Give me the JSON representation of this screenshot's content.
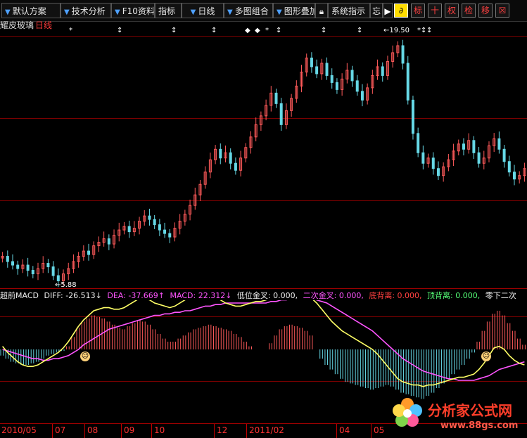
{
  "toolbar": {
    "default_scheme": "默认方案",
    "tech_analysis": "技术分析",
    "f10": "F10资料",
    "indicator": "指标",
    "daily": "日线",
    "multi_chart": "多图组合",
    "overlay": "图形叠加",
    "system_indicator": "系统指示",
    "wisdom": "忘",
    "btn_play": "▶",
    "btn_biao": "标",
    "btn_plus": "十",
    "btn_quan": "权",
    "btn_cha": "检",
    "btn_move": "移",
    "btn_zoom": "☒"
  },
  "stock": {
    "name": "耀皮玻璃",
    "period": "日线"
  },
  "price_chart": {
    "high_label": "19.50",
    "low_label": "5.88",
    "markers": [
      "*",
      "↕",
      "↕",
      "↕",
      "◆",
      "◆",
      "*",
      "↕",
      "↕",
      "↕",
      "↕",
      "↕",
      "*"
    ]
  },
  "macd_header": {
    "name": "超前MACD",
    "diff": "DIFF: -26.513↓",
    "dea": "DEA: -37.669↑",
    "macd": "MACD: 22.312↓",
    "low_gold": "低位金叉: 0.000,",
    "second_gold": "二次金叉: 0.000,",
    "bottom_div": "底背离: 0.000,",
    "top_div": "顶背离: 0.000,",
    "zero_second": "零下二次"
  },
  "x_axis": {
    "labels": [
      "2010/05",
      "07",
      "08",
      "09",
      "10",
      "12",
      "2011/02",
      "04",
      "05"
    ]
  },
  "brand": {
    "title": "分析家公式网",
    "url": "www.88gs.com"
  },
  "colors": {
    "up": "#ff5a5a",
    "down": "#66d8e6",
    "diff": "#ffff66",
    "dea": "#ff55ff",
    "grid": "#7a0000"
  },
  "chart_data": {
    "type": "candlestick",
    "price_range": [
      5.88,
      19.5
    ],
    "closes": [
      7.3,
      7.0,
      6.8,
      6.6,
      6.8,
      6.5,
      6.3,
      6.6,
      6.9,
      6.7,
      6.2,
      5.9,
      6.3,
      6.6,
      7.0,
      7.3,
      7.6,
      7.4,
      7.9,
      8.1,
      8.3,
      8.0,
      8.5,
      8.8,
      9.0,
      8.7,
      8.9,
      9.3,
      9.6,
      9.4,
      9.1,
      8.8,
      8.6,
      8.4,
      8.9,
      9.3,
      9.7,
      10.2,
      10.8,
      11.4,
      12.1,
      12.8,
      13.4,
      12.9,
      13.2,
      12.6,
      12.2,
      12.9,
      13.5,
      14.1,
      14.8,
      15.3,
      15.9,
      16.6,
      16.0,
      14.8,
      15.6,
      16.3,
      17.0,
      17.8,
      18.6,
      18.1,
      17.7,
      18.3,
      17.6,
      17.2,
      16.8,
      17.4,
      17.9,
      17.3,
      16.7,
      16.2,
      16.9,
      17.6,
      18.1,
      17.6,
      18.4,
      18.9,
      19.3,
      18.3,
      16.2,
      14.3,
      13.2,
      12.6,
      12.9,
      12.3,
      11.9,
      12.4,
      12.8,
      13.3,
      13.7,
      13.4,
      13.9,
      13.2,
      12.6,
      12.9,
      13.6,
      14.0,
      13.4,
      12.7,
      12.1,
      11.7,
      11.9,
      12.3
    ],
    "macd_bars": [
      -0.4,
      -0.6,
      -0.8,
      -0.9,
      -1.0,
      -1.0,
      -0.9,
      -0.8,
      -0.6,
      -0.4,
      -0.3,
      -0.2,
      -0.1,
      0.2,
      0.8,
      1.4,
      1.8,
      2.0,
      2.2,
      2.1,
      2.0,
      1.8,
      1.6,
      1.4,
      1.3,
      1.5,
      1.7,
      1.9,
      1.8,
      1.6,
      1.3,
      1.0,
      0.7,
      0.5,
      0.5,
      0.7,
      0.9,
      1.1,
      1.3,
      1.4,
      1.5,
      1.6,
      1.5,
      1.4,
      1.3,
      1.2,
      1.0,
      0.8,
      0.5,
      0.2,
      0.0,
      0.0,
      0.0,
      0.4,
      0.9,
      1.3,
      1.5,
      1.6,
      1.5,
      1.4,
      1.2,
      0.9,
      0.0,
      -0.6,
      -1.0,
      -1.3,
      -1.6,
      -1.9,
      -2.1,
      -2.2,
      -2.3,
      -2.4,
      -2.5,
      -2.6,
      -2.5,
      -2.4,
      -2.3,
      -2.4,
      -2.6,
      -2.8,
      -2.9,
      -3.0,
      -3.1,
      -3.2,
      -3.0,
      -2.8,
      -2.5,
      -2.2,
      -1.9,
      -1.6,
      -1.3,
      -1.0,
      -0.6,
      -0.2,
      0.5,
      1.2,
      1.8,
      2.3,
      2.5,
      2.2,
      1.7,
      1.2,
      0.7,
      0.3
    ],
    "diff": [
      0.2,
      -0.2,
      -0.5,
      -0.8,
      -1.0,
      -1.1,
      -1.1,
      -1.0,
      -0.8,
      -0.6,
      -0.4,
      -0.2,
      0.1,
      0.5,
      1.0,
      1.5,
      1.9,
      2.2,
      2.5,
      2.6,
      2.7,
      2.7,
      2.6,
      2.6,
      2.7,
      2.9,
      3.1,
      3.3,
      3.3,
      3.2,
      3.0,
      2.9,
      2.8,
      2.7,
      2.8,
      3.0,
      3.2,
      3.4,
      3.5,
      3.6,
      3.7,
      3.6,
      3.4,
      3.2,
      3.0,
      2.9,
      2.8,
      2.8,
      2.9,
      3.0,
      3.1,
      3.1,
      3.2,
      3.3,
      3.4,
      3.5,
      3.6,
      3.7,
      3.7,
      3.6,
      3.5,
      3.3,
      3.0,
      2.6,
      2.2,
      1.8,
      1.5,
      1.2,
      1.0,
      0.8,
      0.6,
      0.4,
      0.2,
      0.0,
      -0.3,
      -0.7,
      -1.1,
      -1.5,
      -1.9,
      -2.1,
      -2.2,
      -2.3,
      -2.3,
      -2.4,
      -2.3,
      -2.3,
      -2.2,
      -2.1,
      -2.0,
      -1.9,
      -1.8,
      -1.8,
      -1.7,
      -1.6,
      -1.3,
      -0.9,
      -0.4,
      0.1,
      0.2,
      0.0,
      -0.4,
      -0.7,
      -0.9,
      -1.0
    ],
    "dea": [
      0.0,
      -0.1,
      -0.2,
      -0.3,
      -0.4,
      -0.5,
      -0.6,
      -0.6,
      -0.7,
      -0.7,
      -0.6,
      -0.6,
      -0.5,
      -0.4,
      -0.2,
      0.0,
      0.3,
      0.5,
      0.7,
      0.9,
      1.1,
      1.3,
      1.4,
      1.5,
      1.6,
      1.7,
      1.8,
      1.9,
      2.0,
      2.1,
      2.2,
      2.2,
      2.3,
      2.3,
      2.4,
      2.4,
      2.5,
      2.5,
      2.6,
      2.7,
      2.8,
      2.8,
      2.9,
      2.9,
      3.0,
      3.0,
      3.0,
      3.0,
      3.0,
      3.0,
      3.0,
      3.0,
      3.0,
      3.1,
      3.1,
      3.2,
      3.2,
      3.3,
      3.3,
      3.3,
      3.3,
      3.3,
      3.2,
      3.1,
      3.0,
      2.8,
      2.6,
      2.4,
      2.2,
      2.0,
      1.8,
      1.6,
      1.4,
      1.2,
      0.9,
      0.6,
      0.3,
      0.0,
      -0.3,
      -0.6,
      -0.8,
      -1.0,
      -1.2,
      -1.4,
      -1.5,
      -1.6,
      -1.7,
      -1.8,
      -1.9,
      -1.9,
      -2.0,
      -2.0,
      -2.0,
      -2.0,
      -1.9,
      -1.8,
      -1.7,
      -1.5,
      -1.3,
      -1.2,
      -1.1,
      -1.0,
      -0.9,
      -0.8
    ]
  }
}
